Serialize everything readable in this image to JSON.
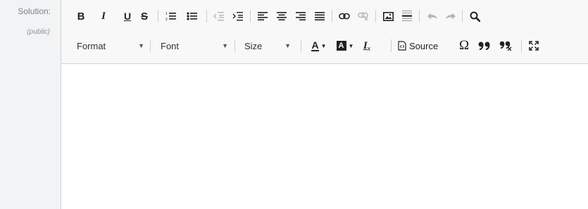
{
  "field": {
    "label": "Solution:",
    "sublabel": "(public)"
  },
  "toolbar": {
    "row1": [
      {
        "name": "bold-button",
        "glyph": "B"
      },
      {
        "name": "italic-button",
        "glyph": "I"
      },
      {
        "name": "underline-button",
        "glyph": "U"
      },
      {
        "name": "strikethrough-button",
        "glyph": "S"
      }
    ],
    "format_label": "Format",
    "font_label": "Font",
    "size_label": "Size",
    "source_label": "Source",
    "special_char_glyph": "Ω",
    "text_color_glyph": "A",
    "bg_color_glyph": "A",
    "remove_format_glyph": "I",
    "remove_format_sub": "x"
  },
  "icons": {
    "numbered-list": "numbered-list-icon",
    "bulleted-list": "bulleted-list-icon",
    "decrease-indent": "decrease-indent-icon",
    "increase-indent": "increase-indent-icon",
    "align-left": "align-left-icon",
    "align-center": "align-center-icon",
    "align-right": "align-right-icon",
    "justify": "justify-icon",
    "link": "link-icon",
    "unlink": "unlink-icon",
    "image": "image-icon",
    "horizontal-line": "horizontal-line-icon",
    "undo": "undo-icon",
    "redo": "redo-icon",
    "find": "search-icon",
    "blockquote": "blockquote-icon",
    "maximize": "maximize-icon"
  },
  "editor_content": ""
}
